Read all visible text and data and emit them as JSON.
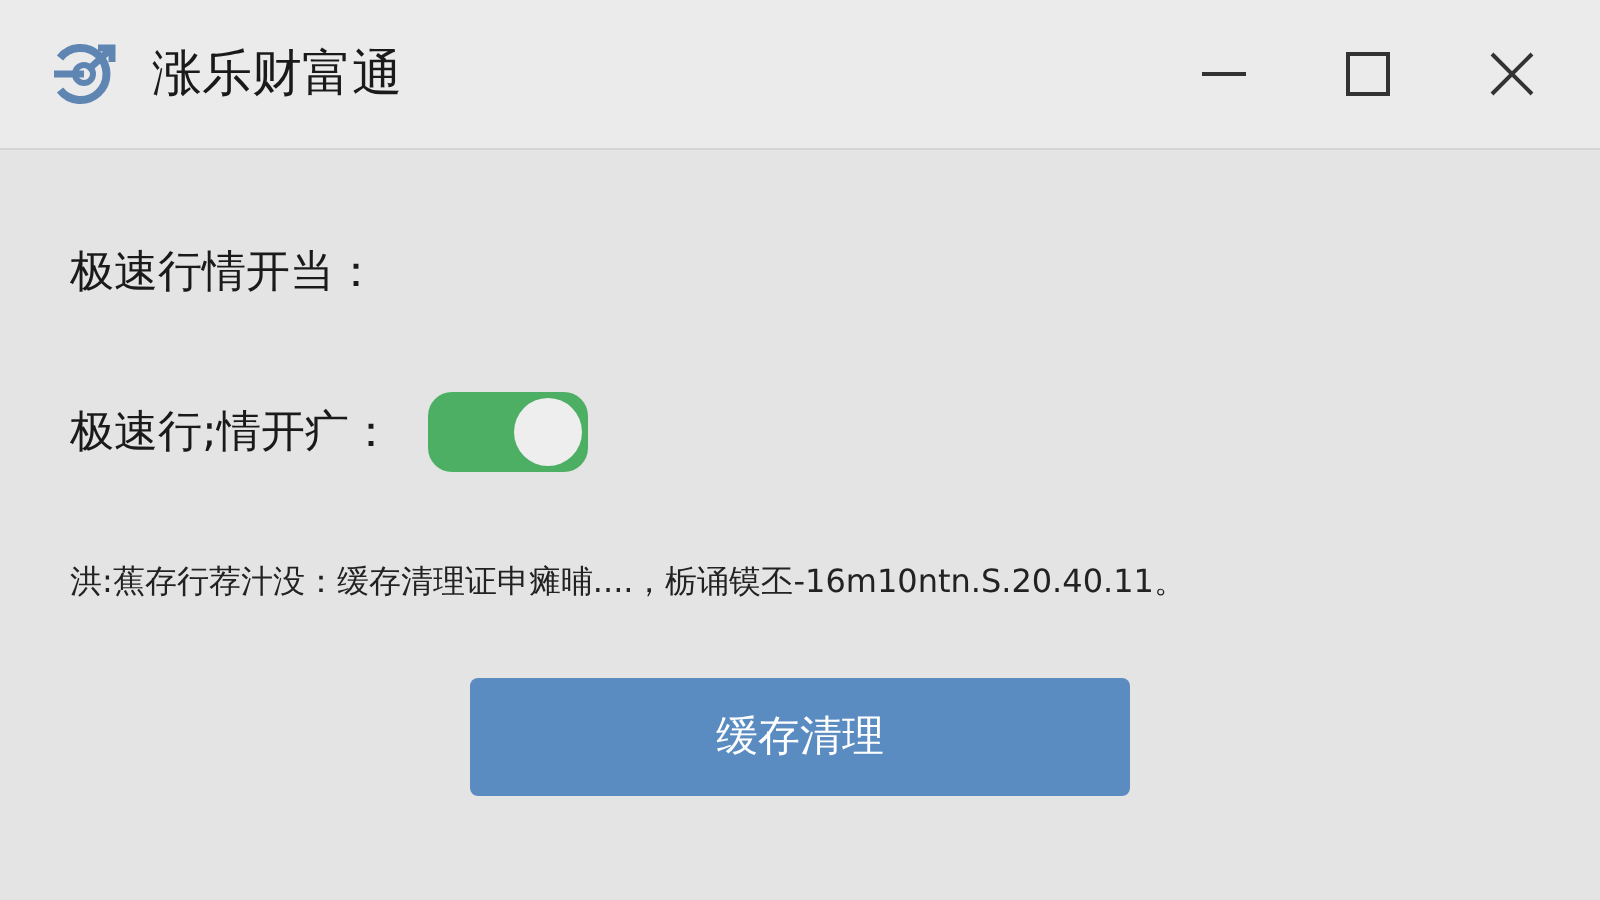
{
  "window": {
    "title": "涨乐财富通"
  },
  "settings": [
    {
      "label": "极速行情开当：",
      "kind": "plain"
    },
    {
      "label": "极速行;情开疒：",
      "kind": "switch",
      "on": true
    }
  ],
  "info": "洪:蕉存行荐汁没：缓存清理证申瘫晡....，栃诵镆丕-16m10ntn.S.20.40.11。",
  "button": "缓存清理"
}
